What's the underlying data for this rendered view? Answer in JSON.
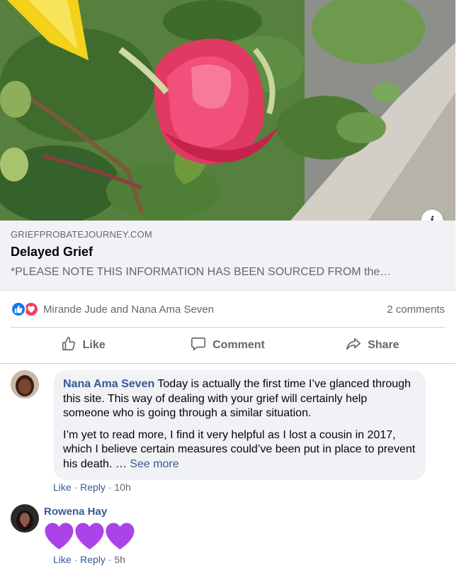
{
  "link_preview": {
    "domain": "GRIEFPROBATEJOURNEY.COM",
    "title": "Delayed Grief",
    "description": "*PLEASE NOTE THIS INFORMATION HAS BEEN SOURCED FROM the…",
    "info_glyph": "i"
  },
  "reactions": {
    "icons": [
      "like-icon",
      "love-icon"
    ],
    "names": "Mirande Jude and Nana Ama Seven",
    "comment_count": "2 comments"
  },
  "actions": {
    "like_label": "Like",
    "comment_label": "Comment",
    "share_label": "Share"
  },
  "comments": [
    {
      "author": "Nana Ama Seven",
      "text_1": "Today is actually the first time I’ve glanced through this site. This way of dealing with your grief will certainly help someone who is going through a similar situation.",
      "text_2": "I’m yet to read more, I find it very helpful as I lost a cousin in 2017, which I believe certain measures could’ve been put in place to prevent his death. … ",
      "see_more": "See more",
      "like": "Like",
      "reply": "Reply",
      "time": "10h"
    },
    {
      "author": "Rowena Hay",
      "content": "purple-heart-emoji x3",
      "like": "Like",
      "reply": "Reply",
      "time": "5h"
    }
  ],
  "colors": {
    "link_blue": "#385898",
    "like_blue": "#1877f2",
    "love_red": "#f33e58",
    "gray_text": "#65676b",
    "bubble_bg": "#f0f2f5",
    "heart_purple": "#aa43e8"
  }
}
